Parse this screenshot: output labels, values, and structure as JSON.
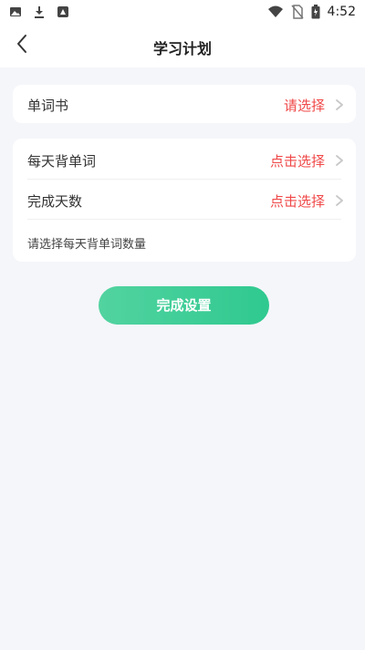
{
  "status_bar": {
    "time": "4:52",
    "left_icons": [
      "image-icon",
      "download-icon",
      "app-icon"
    ],
    "right_icons": [
      "wifi-icon",
      "no-sim-icon",
      "battery-icon"
    ]
  },
  "header": {
    "title": "学习计划",
    "back_icon": "chevron-left-icon"
  },
  "word_book": {
    "label": "单词书",
    "value": "请选择"
  },
  "plan": {
    "daily_words_label": "每天背单词",
    "daily_words_value": "点击选择",
    "days_label": "完成天数",
    "days_value": "点击选择",
    "hint": "请选择每天背单词数量"
  },
  "finish_button": {
    "label": "完成设置"
  },
  "colors": {
    "accent_red": "#f04848",
    "button_green_start": "#52d3a0",
    "button_green_end": "#2fc98f",
    "background": "#f5f6fa"
  }
}
